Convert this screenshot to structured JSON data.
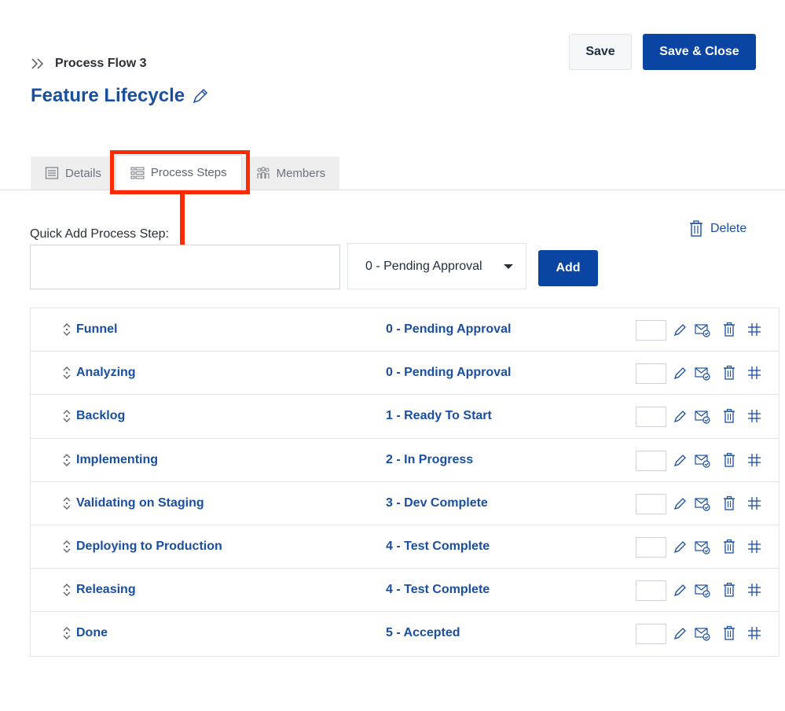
{
  "header": {
    "breadcrumb": "Process Flow 3",
    "title": "Feature Lifecycle",
    "save_label": "Save",
    "save_close_label": "Save & Close"
  },
  "tabs": [
    {
      "label": "Details",
      "icon": "document-icon"
    },
    {
      "label": "Process Steps",
      "icon": "list-icon"
    },
    {
      "label": "Members",
      "icon": "people-icon"
    }
  ],
  "annotation_color": "#ff2a00",
  "quick_add": {
    "label": "Quick Add Process Step:",
    "input_value": "",
    "input_placeholder": "",
    "selected_state": "0 - Pending Approval",
    "add_label": "Add"
  },
  "delete_label": "Delete",
  "steps": [
    {
      "name": "Funnel",
      "state": "0 - Pending Approval"
    },
    {
      "name": "Analyzing",
      "state": "0 - Pending Approval"
    },
    {
      "name": "Backlog",
      "state": "1 - Ready To Start"
    },
    {
      "name": "Implementing",
      "state": "2 - In Progress"
    },
    {
      "name": "Validating on Staging",
      "state": "3 - Dev Complete"
    },
    {
      "name": "Deploying to Production",
      "state": "4 - Test Complete"
    },
    {
      "name": "Releasing",
      "state": "4 - Test Complete"
    },
    {
      "name": "Done",
      "state": "5 - Accepted"
    }
  ],
  "colors": {
    "accent": "#0a45a4",
    "link": "#1a4fa0"
  }
}
